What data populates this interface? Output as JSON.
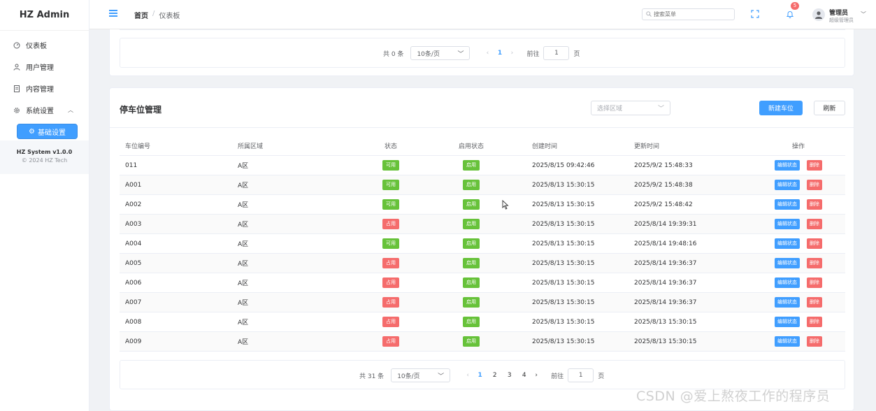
{
  "app": {
    "brand": "HZ Admin"
  },
  "sidebar": {
    "items": [
      {
        "label": "仪表板",
        "icon": "dashboard-icon"
      },
      {
        "label": "用户管理",
        "icon": "user-icon"
      },
      {
        "label": "内容管理",
        "icon": "document-icon"
      },
      {
        "label": "系统设置",
        "icon": "gear-icon"
      }
    ],
    "active_sub": "基础设置",
    "system_version": "HZ System v1.0.0",
    "copyright": "© 2024 HZ Tech"
  },
  "header": {
    "breadcrumb_home": "首页",
    "breadcrumb_sep": "/",
    "breadcrumb_current": "仪表板",
    "search_placeholder": "搜索菜单",
    "notification_count": "5",
    "user_name": "管理员",
    "user_role": "超级管理员"
  },
  "top_pager": {
    "total": "共 0 条",
    "page_size": "10条/页",
    "current_page": "1",
    "goto_label": "前往",
    "goto_value": "1",
    "goto_suffix": "页"
  },
  "parking": {
    "title": "停车位管理",
    "region_placeholder": "选择区域",
    "new_button": "新建车位",
    "refresh_button": "刷新",
    "columns": [
      "车位编号",
      "所属区域",
      "状态",
      "启用状态",
      "创建时间",
      "更新时间",
      "操作"
    ],
    "action_edit": "编辑状态",
    "action_delete": "删除",
    "status_colors": {
      "可用": "#67c23a",
      "占用": "#f56c6c",
      "启用": "#67c23a"
    },
    "rows": [
      {
        "id": "011",
        "region": "A区",
        "status": "可用",
        "enabled": "启用",
        "created": "2025/8/15 09:42:46",
        "updated": "2025/9/2 15:48:33"
      },
      {
        "id": "A001",
        "region": "A区",
        "status": "可用",
        "enabled": "启用",
        "created": "2025/8/13 15:30:15",
        "updated": "2025/9/2 15:48:38"
      },
      {
        "id": "A002",
        "region": "A区",
        "status": "可用",
        "enabled": "启用",
        "created": "2025/8/13 15:30:15",
        "updated": "2025/9/2 15:48:42"
      },
      {
        "id": "A003",
        "region": "A区",
        "status": "占用",
        "enabled": "启用",
        "created": "2025/8/13 15:30:15",
        "updated": "2025/8/14 19:39:31"
      },
      {
        "id": "A004",
        "region": "A区",
        "status": "可用",
        "enabled": "启用",
        "created": "2025/8/13 15:30:15",
        "updated": "2025/8/14 19:48:16"
      },
      {
        "id": "A005",
        "region": "A区",
        "status": "占用",
        "enabled": "启用",
        "created": "2025/8/13 15:30:15",
        "updated": "2025/8/14 19:36:37"
      },
      {
        "id": "A006",
        "region": "A区",
        "status": "占用",
        "enabled": "启用",
        "created": "2025/8/13 15:30:15",
        "updated": "2025/8/14 19:36:37"
      },
      {
        "id": "A007",
        "region": "A区",
        "status": "占用",
        "enabled": "启用",
        "created": "2025/8/13 15:30:15",
        "updated": "2025/8/14 19:36:37"
      },
      {
        "id": "A008",
        "region": "A区",
        "status": "占用",
        "enabled": "启用",
        "created": "2025/8/13 15:30:15",
        "updated": "2025/8/13 15:30:15"
      },
      {
        "id": "A009",
        "region": "A区",
        "status": "占用",
        "enabled": "启用",
        "created": "2025/8/13 15:30:15",
        "updated": "2025/8/13 15:30:15"
      }
    ]
  },
  "bottom_pager": {
    "total": "共 31 条",
    "page_size": "10条/页",
    "pages": [
      "1",
      "2",
      "3",
      "4"
    ],
    "goto_label": "前往",
    "goto_value": "1",
    "goto_suffix": "页"
  },
  "watermark": "CSDN @爱上熬夜工作的程序员"
}
